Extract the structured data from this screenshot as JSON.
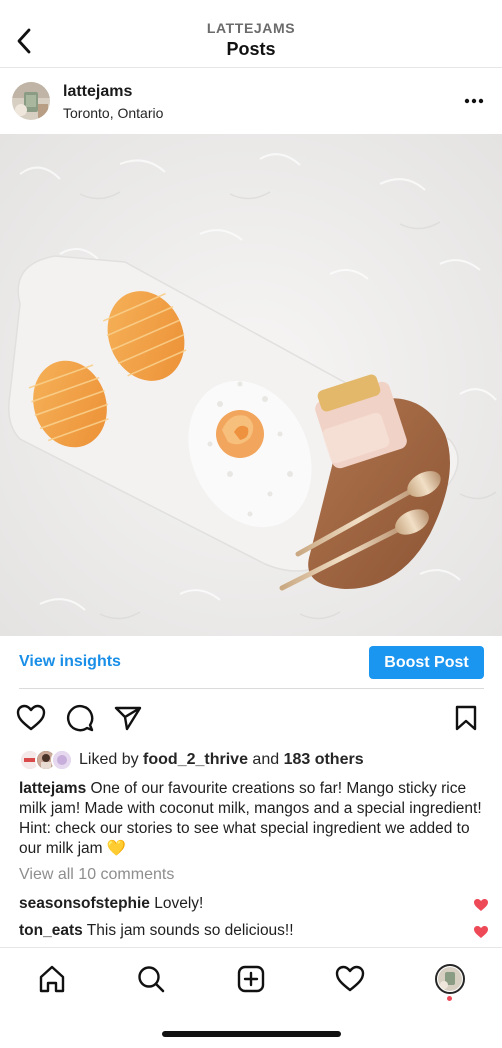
{
  "header": {
    "username": "LATTEJAMS",
    "title": "Posts"
  },
  "post": {
    "username": "lattejams",
    "location": "Toronto, Ontario"
  },
  "insights": {
    "view_label": "View insights",
    "boost_label": "Boost Post"
  },
  "likes": {
    "prefix": "Liked by ",
    "liker": "food_2_thrive",
    "middle": " and ",
    "others": "183 others"
  },
  "caption": {
    "username": "lattejams",
    "text": "One of our favourite creations so far! Mango sticky rice milk jam! Made with coconut milk, mangos and a special ingredient! Hint: check our stories to see what special ingredient we added to our milk jam",
    "emoji": "💛"
  },
  "view_comments": "View all 10 comments",
  "comments": [
    {
      "username": "seasonsofstephie",
      "text": "Lovely!"
    },
    {
      "username": "ton_eats",
      "text": "This jam sounds so delicious!!"
    }
  ],
  "colors": {
    "accent": "#1a95f0",
    "link": "#1a8fe8",
    "like_red": "#ed4956"
  },
  "icons": {
    "back": "chevron-left-icon",
    "more": "more-horizontal-icon",
    "like": "heart-outline-icon",
    "comment": "comment-bubble-icon",
    "share": "send-icon",
    "save": "bookmark-icon",
    "home": "home-icon",
    "search": "search-icon",
    "create": "add-post-icon",
    "activity": "heart-icon"
  }
}
